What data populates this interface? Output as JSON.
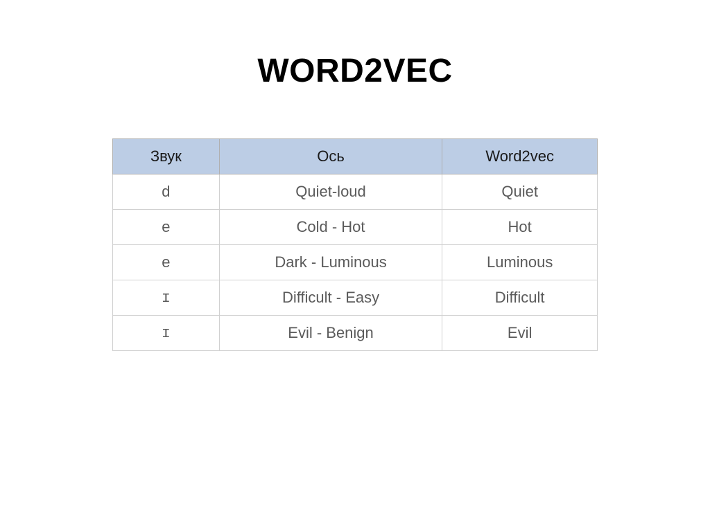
{
  "title": "WORD2VEC",
  "table": {
    "headers": [
      "Звук",
      "Ось",
      "Word2vec"
    ],
    "rows": [
      {
        "sound": "d",
        "axis": "Quiet-loud",
        "result": "Quiet"
      },
      {
        "sound": "e",
        "axis": "Cold - Hot",
        "result": "Hot"
      },
      {
        "sound": "e",
        "axis": "Dark - Luminous",
        "result": "Luminous"
      },
      {
        "sound": "ɪ",
        "axis": "Difficult - Easy",
        "result": "Difficult"
      },
      {
        "sound": "ɪ",
        "axis": "Evil - Benign",
        "result": "Evil"
      }
    ]
  }
}
